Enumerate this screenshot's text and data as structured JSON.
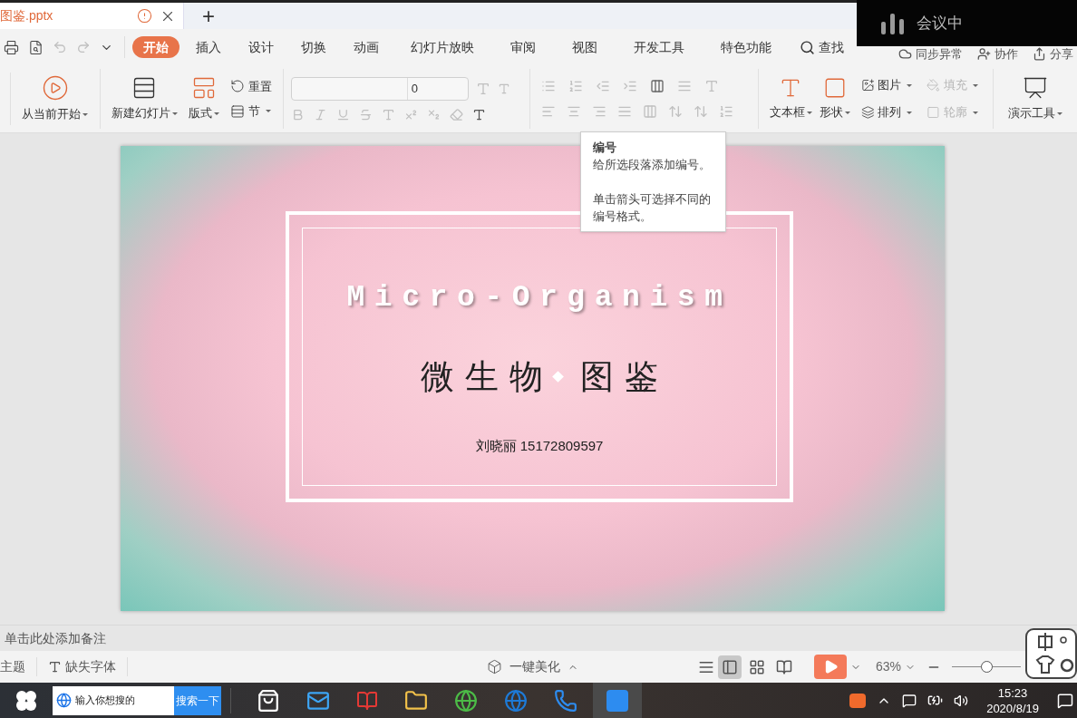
{
  "doc_tab": {
    "title": "图鉴.pptx",
    "new_tab": "+"
  },
  "meeting_overlay": {
    "label": "会议中"
  },
  "menu_tabs": [
    {
      "label": "开始",
      "selected": true
    },
    {
      "label": "插入",
      "selected": false
    },
    {
      "label": "设计",
      "selected": false
    },
    {
      "label": "切换",
      "selected": false
    },
    {
      "label": "动画",
      "selected": false
    },
    {
      "label": "幻灯片放映",
      "selected": false
    },
    {
      "label": "审阅",
      "selected": false
    },
    {
      "label": "视图",
      "selected": false
    },
    {
      "label": "开发工具",
      "selected": false
    },
    {
      "label": "特色功能",
      "selected": false
    }
  ],
  "search": {
    "label": "查找"
  },
  "right_actions": [
    {
      "kind": "sync",
      "label": "同步异常"
    },
    {
      "kind": "collab",
      "label": "协作"
    },
    {
      "kind": "share",
      "label": "分享"
    }
  ],
  "ribbon": {
    "play_from_current": "从当前开始",
    "new_slide": "新建幻灯片",
    "layout": "版式",
    "reset": "重置",
    "section": "节",
    "font_size": "0",
    "text_box": "文本框",
    "shape": "形状",
    "small_tools": [
      {
        "kind": "picture",
        "label": "图片",
        "disabled": false
      },
      {
        "kind": "fill",
        "label": "填充",
        "disabled": true
      },
      {
        "kind": "arrange",
        "label": "排列",
        "disabled": false
      },
      {
        "kind": "outline",
        "label": "轮廓",
        "disabled": true
      }
    ],
    "presentation_tools": "演示工具"
  },
  "tooltip": {
    "title": "编号",
    "lines": [
      "给所选段落添加编号。",
      "单击箭头可选择不同的编号格式。"
    ]
  },
  "slide": {
    "title_en": "Micro-Organism",
    "title_cn_left": "微 生 物",
    "title_cn_right": "图 鉴",
    "author": "刘晓丽 15172809597"
  },
  "notes": {
    "placeholder": "单击此处添加备注"
  },
  "status_bar": {
    "theme": "主题",
    "missing_font": "缺失字体",
    "beautify": "一键美化",
    "views": [
      {
        "kind": "normal",
        "selected": true
      },
      {
        "kind": "sorter",
        "selected": false
      },
      {
        "kind": "reading",
        "selected": false
      }
    ],
    "zoom": "63%",
    "zoom_slider": {
      "level": 0.5
    }
  },
  "taskbar": {
    "search_placeholder": "输入你想搜的",
    "search_button": "搜索一下",
    "time": "15:23",
    "date": "2020/8/19"
  }
}
